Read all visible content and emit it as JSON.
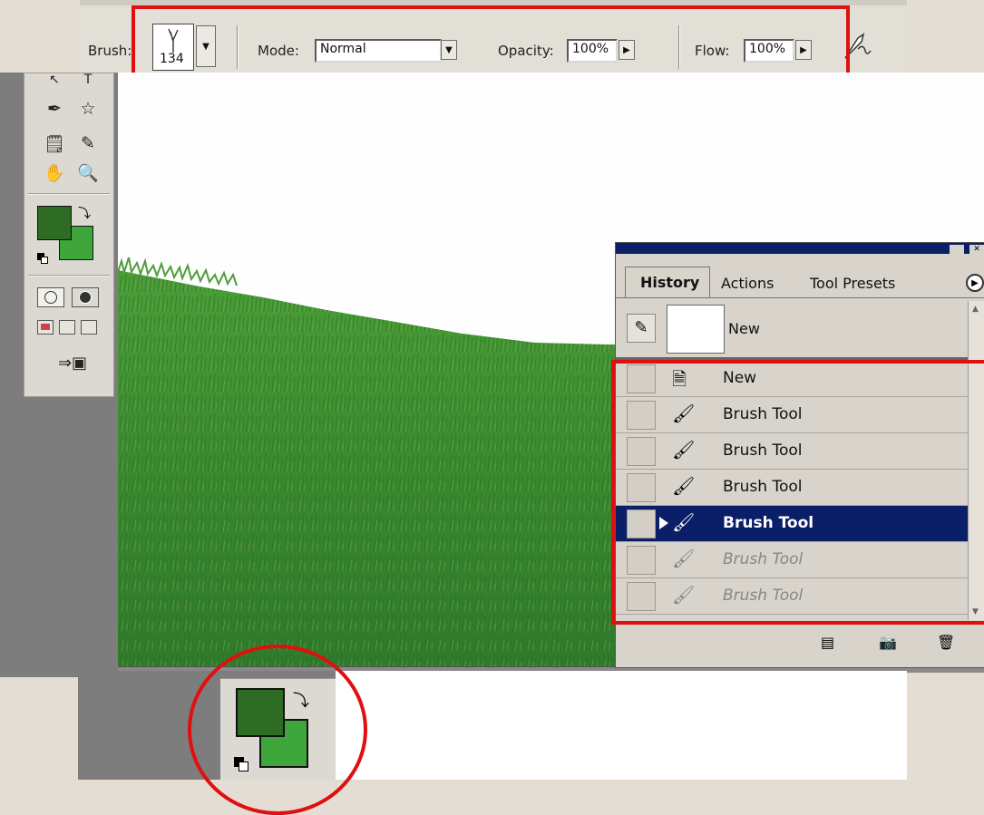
{
  "options_bar": {
    "brush_label": "Brush:",
    "brush_size": "134",
    "mode_label": "Mode:",
    "mode_value": "Normal",
    "opacity_label": "Opacity:",
    "opacity_value": "100%",
    "flow_label": "Flow:",
    "flow_value": "100%"
  },
  "colors": {
    "foreground": "#2e6c25",
    "background": "#3ea63a",
    "highlight": "#e01010",
    "panel_title_bar": "#0b1e68"
  },
  "history_panel": {
    "tabs": [
      "History",
      "Actions",
      "Tool Presets"
    ],
    "snapshot_label": "New",
    "states": [
      {
        "label": "New",
        "icon": "new-document-icon",
        "state": "normal"
      },
      {
        "label": "Brush Tool",
        "icon": "brush-icon",
        "state": "normal"
      },
      {
        "label": "Brush Tool",
        "icon": "brush-icon",
        "state": "normal"
      },
      {
        "label": "Brush Tool",
        "icon": "brush-icon",
        "state": "normal"
      },
      {
        "label": "Brush Tool",
        "icon": "brush-icon",
        "state": "active"
      },
      {
        "label": "Brush Tool",
        "icon": "brush-icon",
        "state": "greyed"
      },
      {
        "label": "Brush Tool",
        "icon": "brush-icon",
        "state": "greyed"
      }
    ]
  },
  "icons": {
    "toolbox": [
      "pen-icon",
      "custom-shape-icon",
      "notes-icon",
      "eyedropper-icon",
      "hand-icon",
      "zoom-icon",
      "standard-mode-icon",
      "quick-mask-icon",
      "screen-mode-icons",
      "jump-to-imageready-icon"
    ],
    "options": [
      "airbrush-icon"
    ],
    "history_footer": [
      "new-document-from-state-icon",
      "new-snapshot-icon",
      "trash-icon"
    ]
  }
}
